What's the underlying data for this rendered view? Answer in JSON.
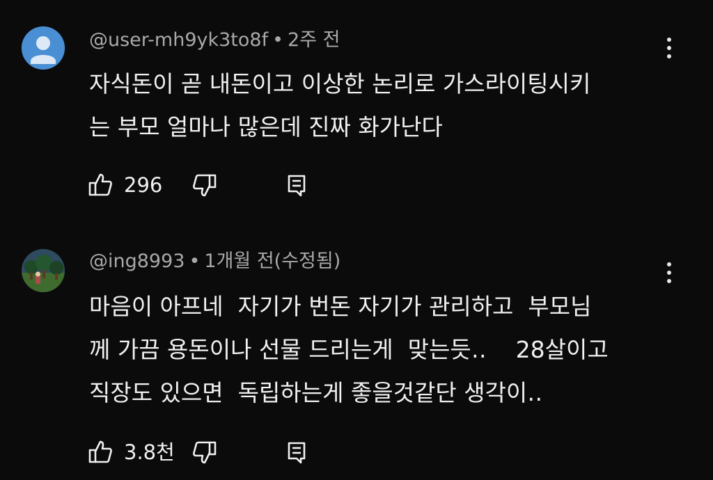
{
  "comments": [
    {
      "author": "@user-mh9yk3to8f",
      "separator": "•",
      "time": "2주 전",
      "lines": [
        "자식돈이 곧 내돈이고 이상한 논리로 가스라이팅시키",
        "는 부모 얼마나 많은데 진짜 화가난다"
      ],
      "likes": "296",
      "icons": {
        "avatar": "default-user-avatar",
        "like": "thumbs-up-icon",
        "dislike": "thumbs-down-icon",
        "reply": "reply-icon",
        "menu": "more-vert-icon"
      }
    },
    {
      "author": "@ing8993",
      "separator": "•",
      "time": "1개월 전(수정됨)",
      "lines": [
        "마음이 아프네  자기가 번돈 자기가 관리하고  부모님",
        "께 가끔 용돈이나 선물 드리는게  맞는듯‥    28살이고",
        "직장도 있으면  독립하는게 좋을것같단 생각이‥"
      ],
      "likes": "3.8천",
      "icons": {
        "avatar": "forest-scene-avatar",
        "like": "thumbs-up-icon",
        "dislike": "thumbs-down-icon",
        "reply": "reply-icon",
        "menu": "more-vert-icon"
      }
    }
  ],
  "colors": {
    "background": "#0b0b0b",
    "text": "#f1f1f1",
    "meta": "#a9a9a9",
    "default_avatar": "#4a8fd3"
  }
}
